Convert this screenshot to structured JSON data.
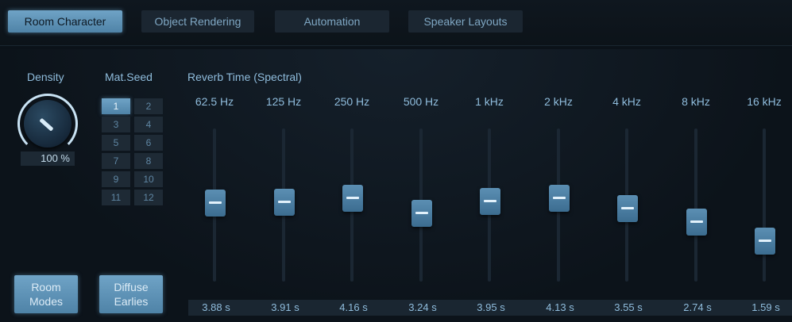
{
  "tabs": [
    {
      "label": "Room Character",
      "active": true
    },
    {
      "label": "Object Rendering",
      "active": false
    },
    {
      "label": "Automation",
      "active": false
    },
    {
      "label": "Speaker Layouts",
      "active": false
    }
  ],
  "density": {
    "label": "Density",
    "value": "100 %",
    "level": 1.0
  },
  "mat_seed": {
    "label": "Mat.Seed",
    "selected": "1",
    "items": [
      "1",
      "2",
      "3",
      "4",
      "5",
      "6",
      "7",
      "8",
      "9",
      "10",
      "11",
      "12"
    ]
  },
  "reverb": {
    "title": "Reverb Time (Spectral)",
    "bands": [
      {
        "freq": "62.5 Hz",
        "value": "3.88 s",
        "seconds": 3.88
      },
      {
        "freq": "125 Hz",
        "value": "3.91 s",
        "seconds": 3.91
      },
      {
        "freq": "250 Hz",
        "value": "4.16 s",
        "seconds": 4.16
      },
      {
        "freq": "500 Hz",
        "value": "3.24 s",
        "seconds": 3.24
      },
      {
        "freq": "1 kHz",
        "value": "3.95 s",
        "seconds": 3.95
      },
      {
        "freq": "2 kHz",
        "value": "4.13 s",
        "seconds": 4.13
      },
      {
        "freq": "4 kHz",
        "value": "3.55 s",
        "seconds": 3.55
      },
      {
        "freq": "8 kHz",
        "value": "2.74 s",
        "seconds": 2.74
      },
      {
        "freq": "16 kHz",
        "value": "1.59 s",
        "seconds": 1.59
      }
    ]
  },
  "buttons": {
    "room_modes": "Room\nModes",
    "diffuse_earlies": "Diffuse\nEarlies"
  },
  "colors": {
    "accent": "#5f93b8",
    "background": "#0b1219",
    "text": "#8fbcdc"
  }
}
